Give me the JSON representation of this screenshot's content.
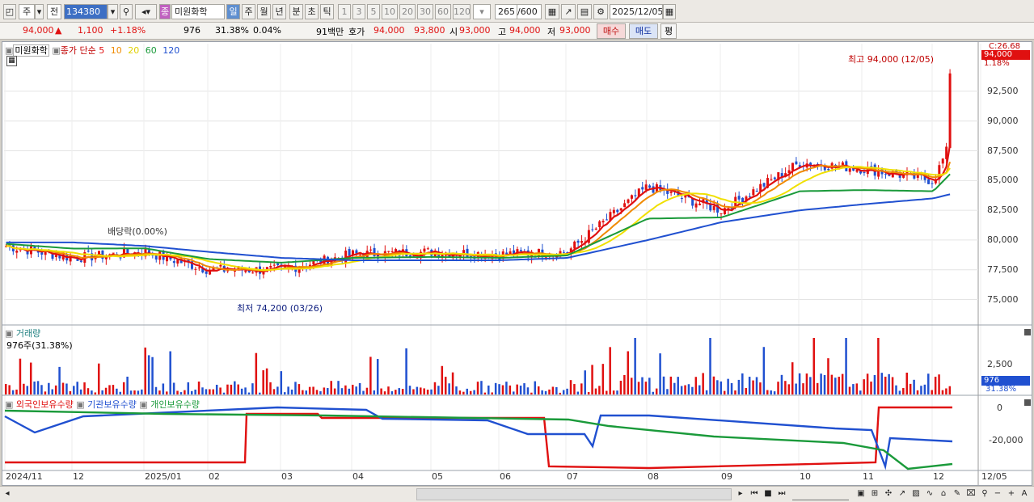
{
  "toolbar": {
    "market": "주",
    "prev": "전",
    "code": "134380",
    "name": "미원화학",
    "periods": [
      "일",
      "주",
      "월",
      "년",
      "분",
      "초",
      "틱"
    ],
    "ticks": [
      "1",
      "3",
      "5",
      "10",
      "20",
      "30",
      "60",
      "120"
    ],
    "count": "265",
    "count_total": "/600",
    "date": "2025/12/05",
    "badge": "종"
  },
  "info": {
    "price": "94,000",
    "arrow": "▲",
    "change": "1,100",
    "pct": "+1.18%",
    "volume": "976",
    "vol_ratio": "31.38%",
    "turnover": "0.04%",
    "amount": "91백만",
    "ask_label": "호가",
    "ask": "94,000",
    "bid": "93,800",
    "open_label": "시",
    "open": "93,000",
    "high_label": "고",
    "high": "94,000",
    "low_label": "저",
    "low": "93,000",
    "buy": "매수",
    "sell": "매도",
    "eval": "평"
  },
  "price_panel": {
    "legend_name": "미원화학",
    "legend_ma": "종가 단순",
    "ma_periods": [
      "5",
      "10",
      "20",
      "60",
      "120"
    ],
    "ma_colors": [
      "#e01010",
      "#f08a00",
      "#f0e000",
      "#1a9a3a",
      "#2050d0"
    ],
    "max_label": "최고 94,000 (12/05)",
    "min_label": "최저 74,200 (03/26)",
    "note": "배당락(0.00%)",
    "yticks": [
      "92,500",
      "90,000",
      "87,500",
      "85,000",
      "82,500",
      "80,000",
      "77,500",
      "75,000"
    ],
    "badge_price": "94,000",
    "badge_pct": "1.18%",
    "top_label": "C:26.68",
    "ylim": [
      73000,
      96500
    ]
  },
  "volume_panel": {
    "title": "거래량",
    "value": "976주(31.38%)",
    "ytick": "2,500",
    "badge": "976",
    "badge_pct": "31.38%"
  },
  "holding_panel": {
    "series": [
      "외국인보유수량",
      "기관보유수량",
      "개인보유수량"
    ],
    "colors": [
      "#e01010",
      "#2050d0",
      "#1a9a3a"
    ],
    "yticks": [
      "0",
      "-20,000"
    ]
  },
  "xaxis": {
    "labels": [
      "2024/11",
      "12",
      "2025/01",
      "02",
      "03",
      "04",
      "05",
      "06",
      "07",
      "08",
      "09",
      "10",
      "11",
      "12",
      "12/05"
    ]
  },
  "chart_data": {
    "type": "line",
    "title": "미원화학",
    "ylim": [
      73000,
      96500
    ],
    "x": [
      "2024/11",
      "12",
      "2025/01",
      "02",
      "03",
      "04",
      "05",
      "06",
      "07",
      "08",
      "09",
      "10",
      "11",
      "12",
      "12/05"
    ],
    "series": [
      {
        "name": "5",
        "values": [
          79500,
          78500,
          79000,
          77500,
          77500,
          78800,
          79000,
          78800,
          79000,
          84500,
          82500,
          86500,
          86000,
          85000,
          94000
        ]
      },
      {
        "name": "120",
        "values": [
          79800,
          79800,
          79500,
          79000,
          78500,
          78300,
          78300,
          78300,
          78500,
          80000,
          81500,
          82500,
          83000,
          83500,
          84500
        ]
      }
    ]
  }
}
